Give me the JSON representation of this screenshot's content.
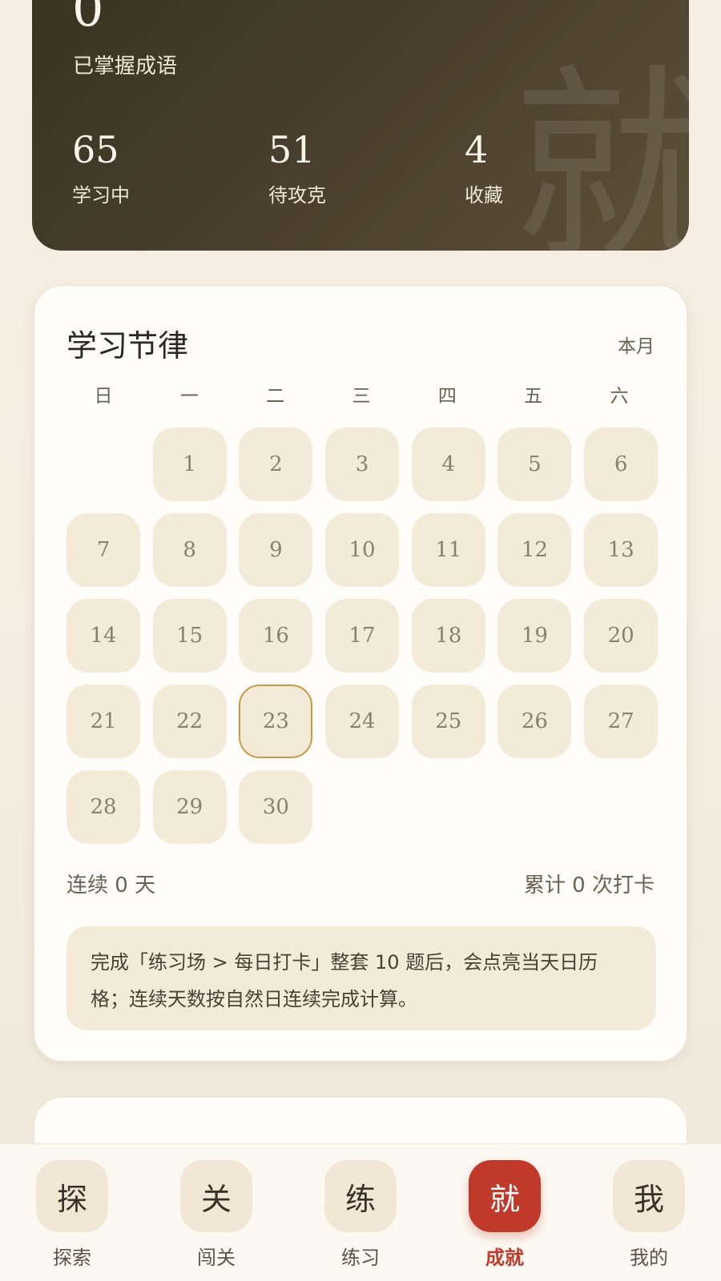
{
  "hero": {
    "main_value": "0",
    "main_label": "已掌握成语",
    "watermark": "就",
    "stats": [
      {
        "value": "65",
        "label": "学习中"
      },
      {
        "value": "51",
        "label": "待攻克"
      },
      {
        "value": "4",
        "label": "收藏"
      }
    ]
  },
  "rhythm": {
    "title": "学习节律",
    "range": "本月",
    "weekdays": [
      "日",
      "一",
      "二",
      "三",
      "四",
      "五",
      "六"
    ],
    "first_weekday_index": 1,
    "days": [
      "1",
      "2",
      "3",
      "4",
      "5",
      "6",
      "7",
      "8",
      "9",
      "10",
      "11",
      "12",
      "13",
      "14",
      "15",
      "16",
      "17",
      "18",
      "19",
      "20",
      "21",
      "22",
      "23",
      "24",
      "25",
      "26",
      "27",
      "28",
      "29",
      "30"
    ],
    "today": "23",
    "streak_text": "连续 0 天",
    "total_text": "累计 0 次打卡",
    "note": "完成「练习场 > 每日打卡」整套 10 题后，会点亮当天日历格；连续天数按自然日连续完成计算。"
  },
  "tabs": [
    {
      "glyph": "探",
      "label": "探索"
    },
    {
      "glyph": "关",
      "label": "闯关"
    },
    {
      "glyph": "练",
      "label": "练习"
    },
    {
      "glyph": "就",
      "label": "成就",
      "active": true
    },
    {
      "glyph": "我",
      "label": "我的"
    }
  ],
  "colors": {
    "accent": "#c0392b",
    "today_border": "#c99a45",
    "cell_bg": "#f3ead8"
  }
}
